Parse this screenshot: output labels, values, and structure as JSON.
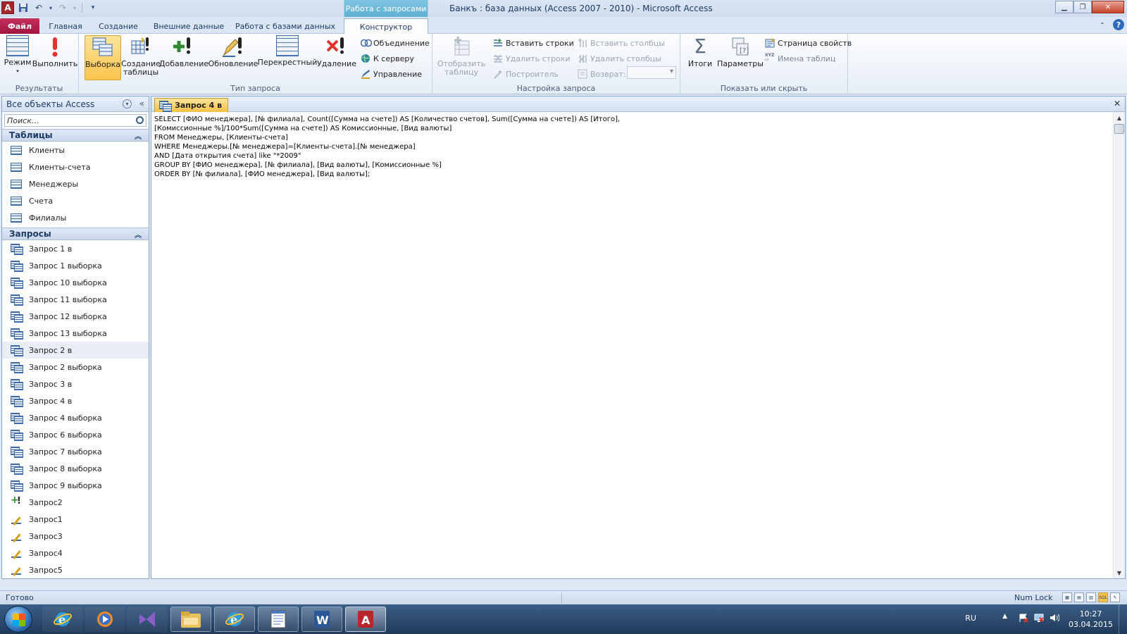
{
  "window": {
    "title": "Банкъ : база данных (Access 2007 - 2010)  -  Microsoft Access",
    "context_tab_header": "Работа с запросами",
    "app_icon_letter": "A"
  },
  "tabs": {
    "file": "Файл",
    "home": "Главная",
    "create": "Создание",
    "external": "Внешние данные",
    "database_tools": "Работа с базами данных",
    "design": "Конструктор"
  },
  "ribbon": {
    "results": {
      "label": "Результаты",
      "view": "Режим",
      "run": "Выполнить"
    },
    "query_type": {
      "label": "Тип запроса",
      "select": "Выборка",
      "make_table_1": "Создание",
      "make_table_2": "таблицы",
      "append": "Добавление",
      "update": "Обновление",
      "crosstab": "Перекрестный",
      "delete": "Удаление",
      "union": "Объединение",
      "pass_through": "К серверу",
      "data_definition": "Управление"
    },
    "query_setup": {
      "label": "Настройка запроса",
      "show_table_1": "Отобразить",
      "show_table_2": "таблицу",
      "insert_rows": "Вставить строки",
      "delete_rows": "Удалить строки",
      "builder": "Построитель",
      "insert_columns": "Вставить столбцы",
      "delete_columns": "Удалить столбцы",
      "return_label": "Возврат:",
      "return_value": ""
    },
    "show_hide": {
      "label": "Показать или скрыть",
      "totals": "Итоги",
      "parameters": "Параметры",
      "property_sheet": "Страница свойств",
      "table_names": "Имена таблиц"
    }
  },
  "nav": {
    "header": "Все объекты Access",
    "search_placeholder": "Поиск...",
    "tables_label": "Таблицы",
    "tables": [
      "Клиенты",
      "Клиенты-счета",
      "Менеджеры",
      "Счета",
      "Филиалы"
    ],
    "queries_label": "Запросы",
    "queries": [
      {
        "name": "Запрос 1 в",
        "type": "select"
      },
      {
        "name": "Запрос 1 выборка",
        "type": "select"
      },
      {
        "name": "Запрос 10 выборка",
        "type": "select"
      },
      {
        "name": "Запрос 11 выборка",
        "type": "select"
      },
      {
        "name": "Запрос 12 выборка",
        "type": "select"
      },
      {
        "name": "Запрос 13 выборка",
        "type": "select"
      },
      {
        "name": "Запрос 2 в",
        "type": "select"
      },
      {
        "name": "Запрос 2 выборка",
        "type": "select"
      },
      {
        "name": "Запрос 3 в",
        "type": "select"
      },
      {
        "name": "Запрос 4 в",
        "type": "select"
      },
      {
        "name": "Запрос 4 выборка",
        "type": "select"
      },
      {
        "name": "Запрос 6 выборка",
        "type": "select"
      },
      {
        "name": "Запрос 7 выборка",
        "type": "select"
      },
      {
        "name": "Запрос 8 выборка",
        "type": "select"
      },
      {
        "name": "Запрос 9 выборка",
        "type": "select"
      },
      {
        "name": "Запрос2",
        "type": "append"
      },
      {
        "name": "Запрос1",
        "type": "update"
      },
      {
        "name": "Запрос3",
        "type": "update"
      },
      {
        "name": "Запрос4",
        "type": "update"
      },
      {
        "name": "Запрос5",
        "type": "update"
      }
    ],
    "hover_query": "Запрос 2 в"
  },
  "document": {
    "tab_label": "Запрос 4 в",
    "sql_lines": [
      "SELECT [ФИО менеджера], [№ филиала], Count([Сумма на счете]) AS [Количество счетов], Sum([Сумма на счете]) AS [Итого],",
      "[Комиссионные %]/100*Sum([Сумма на счете]) AS Комиссионные, [Вид валюты]",
      "FROM Менеджеры, [Клиенты-счета]",
      "WHERE Менеджеры.[№ менеджера]=[Клиенты-счета].[№ менеджера]",
      "AND [Дата открытия счета] like \"*2009\"",
      "GROUP BY [ФИО менеджера], [№ филиала], [Вид валюты], [Комиссионные %]",
      "ORDER BY [№ филиала], [ФИО менеджера], [Вид валюты];"
    ]
  },
  "status": {
    "ready": "Готово",
    "num_lock": "Num Lock",
    "sql_view": "SQL"
  },
  "taskbar": {
    "apps": [
      "ie-icon",
      "media-player-icon",
      "visual-studio-icon",
      "explorer-icon",
      "ie-icon",
      "notepad-icon",
      "word-icon",
      "access-icon"
    ],
    "language": "RU",
    "time": "10:27",
    "date": "03.04.2015"
  },
  "colors": {
    "file_tab": "#a0163e",
    "selected_button": "#f9c44b",
    "context_tab": "#5fb0d6"
  }
}
